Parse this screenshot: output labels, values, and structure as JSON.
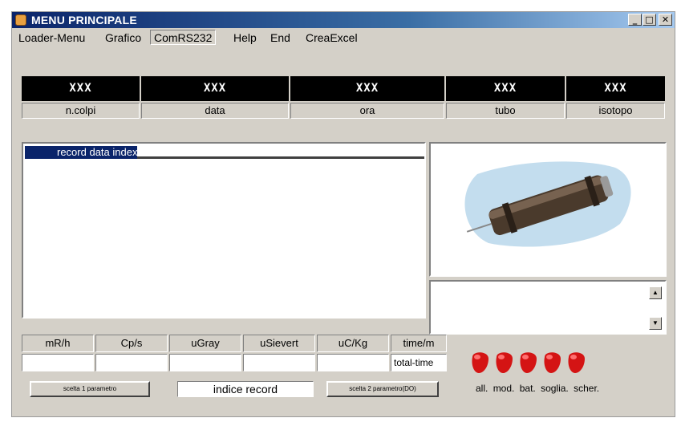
{
  "window": {
    "title": "MENU PRINCIPALE",
    "controls": [
      "_",
      "□",
      "✕"
    ]
  },
  "menu": [
    "Loader-Menu",
    "Grafico",
    "ComRS232",
    "Help",
    "End",
    "CreaExcel"
  ],
  "header": {
    "values": [
      "XXX",
      "XXX",
      "XXX",
      "XXX",
      "XXX"
    ],
    "labels": [
      "n.colpi",
      "data",
      "ora",
      "tubo",
      "isotopo"
    ]
  },
  "list": {
    "selected_text": "record data   index"
  },
  "table": {
    "headers": [
      "mR/h",
      "Cp/s",
      "uGray",
      "uSievert",
      "uC/Kg",
      "time/m"
    ],
    "values": [
      "",
      "",
      "",
      "",
      "",
      "total-time"
    ]
  },
  "controls": {
    "btn1": "scelta 1 parametro",
    "field": "indice record",
    "btn2": "scelta 2 parametro(DO)"
  },
  "indicators": {
    "labels": [
      "all.",
      "mod.",
      "bat.",
      "soglia.",
      "scher."
    ],
    "color": "#d41414"
  }
}
